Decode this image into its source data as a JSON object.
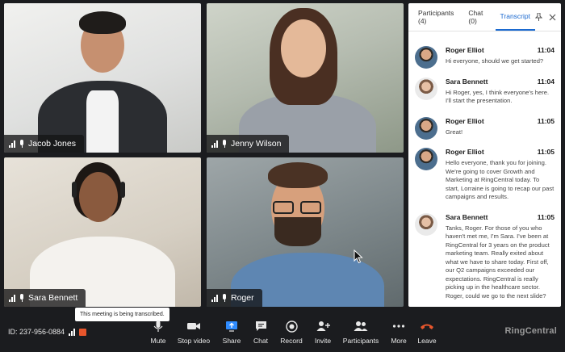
{
  "participants": [
    {
      "name": "Jacob Jones"
    },
    {
      "name": "Jenny Wilson"
    },
    {
      "name": "Sara Bennett"
    },
    {
      "name": "Roger"
    }
  ],
  "panel": {
    "tabs": [
      {
        "label": "Participants (4)"
      },
      {
        "label": "Chat (0)"
      },
      {
        "label": "Transcript"
      }
    ],
    "messages": [
      {
        "author": "Roger Elliot",
        "time": "11:04",
        "text": "Hi everyone, should we get started?"
      },
      {
        "author": "Sara Bennett",
        "time": "11:04",
        "text": "Hi Roger, yes, I think everyone's here. I'll start the presentation."
      },
      {
        "author": "Roger Elliot",
        "time": "11:05",
        "text": "Great!"
      },
      {
        "author": "Roger Elliot",
        "time": "11:05",
        "text": "Hello everyone, thank you for joining. We're going to cover Growth and Marketing at RingCentral today. To start, Lorraine is going to recap our past campaigns and results."
      },
      {
        "author": "Sara Bennett",
        "time": "11:05",
        "text": "Tanks, Roger. For those of you who haven't met me, I'm Sara. I've been at RingCentral for 3 years on the product marketing team. Really exited about what we have to share today. First off, our Q2 campaigns exceeded our expectations. RingCentral is really picking up in the healthcare sector. Roger, could we go to the next slide?"
      }
    ]
  },
  "toolbar": {
    "meeting_id": "ID: 237-956-0884",
    "tooltip": "This meeting is being transcribed.",
    "buttons": [
      {
        "label": "Mute"
      },
      {
        "label": "Stop video"
      },
      {
        "label": "Share"
      },
      {
        "label": "Chat"
      },
      {
        "label": "Record"
      },
      {
        "label": "Invite"
      },
      {
        "label": "Participants"
      },
      {
        "label": "More"
      },
      {
        "label": "Leave"
      }
    ],
    "brand": "RingCentral"
  },
  "colors": {
    "accent": "#1b6ad0",
    "record_badge": "#e8562c",
    "leave": "#e8562c"
  }
}
